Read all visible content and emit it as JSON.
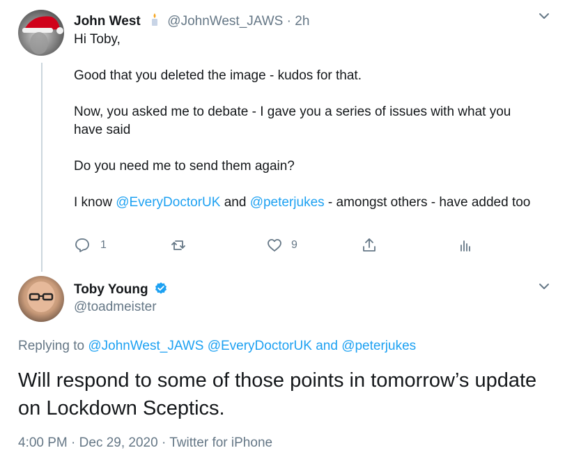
{
  "reply_tweet": {
    "author_name": "John West",
    "badge_icon": "candle-emoji",
    "handle": "@JohnWest_JAWS",
    "separator": " · ",
    "time_ago": "2h",
    "paragraphs": {
      "p1": "Hi Toby,",
      "p2": "Good that you deleted the image - kudos for that.",
      "p3": "Now, you asked me to debate - I gave you a series of issues with what you have said",
      "p4": "Do you need me to send them again?",
      "p5_prefix": "I know ",
      "p5_mention1": "@EveryDoctorUK",
      "p5_and": " and ",
      "p5_mention2": "@peterjukes",
      "p5_suffix": " - amongst others - have added too"
    },
    "actions": {
      "reply_count": "1",
      "retweet_count": "",
      "like_count": "9"
    }
  },
  "main_tweet": {
    "author_name": "Toby Young",
    "verified": true,
    "handle": "@toadmeister",
    "replying_label": "Replying to ",
    "replying_mention1": "@JohnWest_JAWS",
    "replying_space": " ",
    "replying_mention2": "@EveryDoctorUK",
    "replying_and": " and ",
    "replying_mention3": "@peterjukes",
    "text": "Will respond to some of those points in tomorrow’s update on Lockdown Sceptics.",
    "time": "4:00 PM",
    "meta_separator": " · ",
    "date": "Dec 29, 2020",
    "source": "Twitter for iPhone"
  },
  "colors": {
    "accent": "#1da1f2",
    "muted": "#657786",
    "text": "#14171a"
  }
}
